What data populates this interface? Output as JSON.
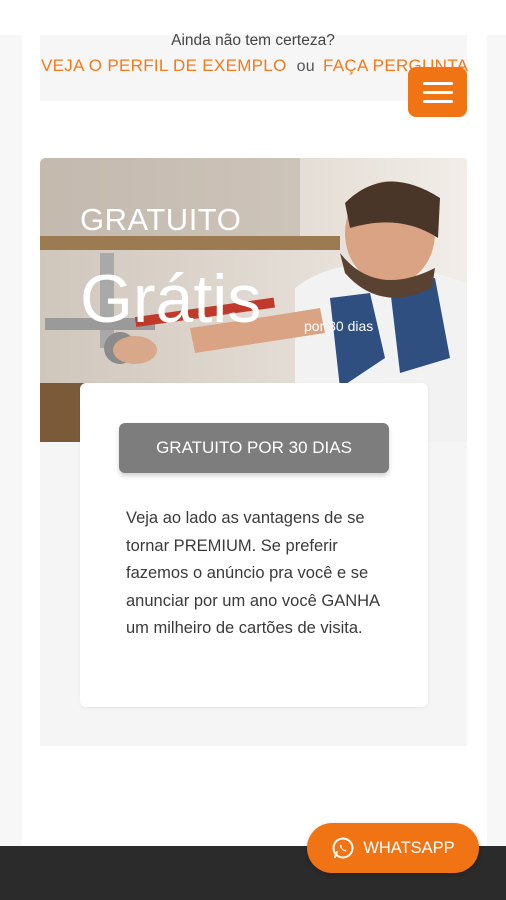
{
  "top": {
    "question": "Ainda não tem certeza?",
    "example_link": "VEJA O PERFIL DE EXEMPLO",
    "separator": "ou",
    "ask_link": "FAÇA PERGUNTA"
  },
  "menu": {
    "icon": "hamburger-menu-icon"
  },
  "plan": {
    "name": "GRATUITO",
    "price": "Grátis",
    "price_suffix": "por 30 dias",
    "button_label": "GRATUITO POR 30 DIAS",
    "description": "Veja ao lado as vantagens de se tornar PREMIUM. Se preferir fazemos o anúncio pra você e se anunciar por um ano você GANHA um milheiro de cartões de visita."
  },
  "whatsapp": {
    "label": "WHATSAPP",
    "icon": "whatsapp-icon"
  },
  "colors": {
    "accent": "#f07414",
    "button_gray": "#7d7d7d",
    "footer": "#2b2b2b"
  }
}
